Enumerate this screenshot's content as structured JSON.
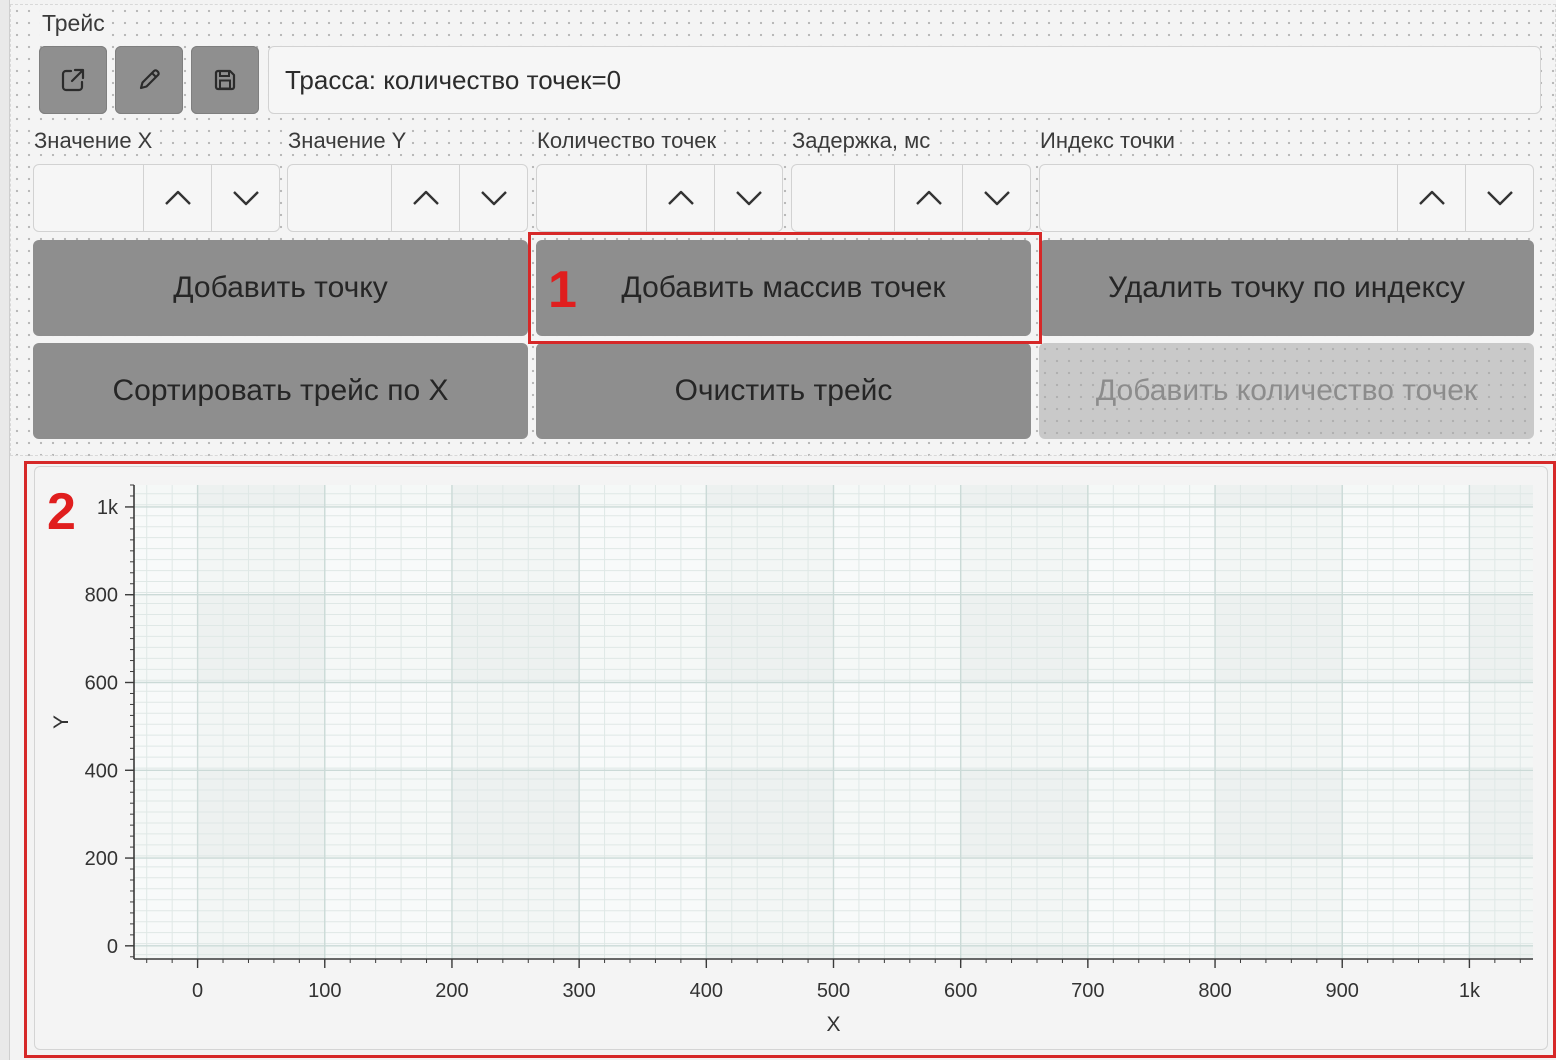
{
  "group": {
    "label": "Трейс"
  },
  "toolbar": {
    "icons": [
      "external-link-icon",
      "pencil-icon",
      "save-icon"
    ]
  },
  "trace": {
    "status_text": "Трасса: количество точек=0"
  },
  "fields": {
    "x_value_label": "Значение X",
    "y_value_label": "Значение Y",
    "points_count_label": "Количество точек",
    "delay_label": "Задержка, мс",
    "point_index_label": "Индекс точки"
  },
  "buttons": {
    "add_point": "Добавить точку",
    "add_points_array": "Добавить массив точек",
    "delete_point_by_index": "Удалить точку по индексу",
    "sort_trace_by_x": "Сортировать трейс по X",
    "clear_trace": "Очистить трейс",
    "add_points_count": "Добавить количество точек"
  },
  "annotations": {
    "marker_1": "1",
    "marker_2": "2",
    "color": "#d62828"
  },
  "chart_data": {
    "type": "scatter",
    "title": "",
    "xlabel": "X",
    "ylabel": "Y",
    "xlim": [
      -50,
      1050
    ],
    "ylim": [
      -30,
      1050
    ],
    "xticks": [
      0,
      100,
      200,
      300,
      400,
      500,
      600,
      700,
      800,
      900,
      1000
    ],
    "xtick_labels": [
      "0",
      "100",
      "200",
      "300",
      "400",
      "500",
      "600",
      "700",
      "800",
      "900",
      "1k"
    ],
    "yticks": [
      0,
      200,
      400,
      600,
      800,
      1000
    ],
    "ytick_labels": [
      "0",
      "200",
      "400",
      "600",
      "800",
      "1k"
    ],
    "series": [],
    "grid": true
  }
}
